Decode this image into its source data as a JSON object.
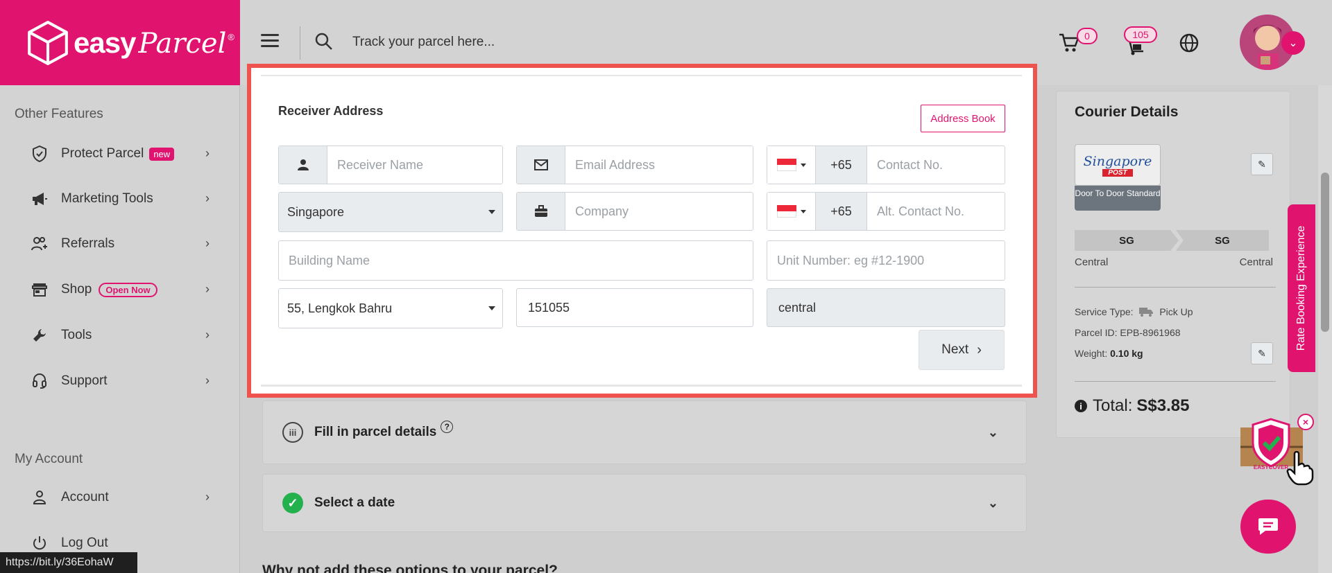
{
  "brand": {
    "easy": "easy",
    "parcel": "Parcel",
    "reg": "®",
    "color": "#e0146f"
  },
  "topbar": {
    "search_placeholder": "Track your parcel here...",
    "cart_count": "0",
    "notif_count": "105"
  },
  "sidebar": {
    "section_other": "Other Features",
    "items": [
      {
        "label": "Protect Parcel",
        "badge": "new",
        "icon": "shield-icon"
      },
      {
        "label": "Marketing Tools",
        "icon": "megaphone-icon"
      },
      {
        "label": "Referrals",
        "icon": "users-icon"
      },
      {
        "label": "Shop",
        "badge": "Open Now",
        "icon": "store-icon"
      },
      {
        "label": "Tools",
        "icon": "wrench-icon"
      },
      {
        "label": "Support",
        "icon": "headset-icon"
      }
    ],
    "section_account": "My Account",
    "account_items": [
      {
        "label": "Account",
        "icon": "user-icon"
      },
      {
        "label": "Log Out",
        "icon": "power-icon"
      }
    ]
  },
  "status_url": "https://bit.ly/36EohaW",
  "receiver": {
    "title": "Receiver Address",
    "address_book": "Address Book",
    "name_placeholder": "Receiver Name",
    "email_placeholder": "Email Address",
    "dial_code": "+65",
    "contact_placeholder": "Contact No.",
    "country": "Singapore",
    "company_placeholder": "Company",
    "alt_dial_code": "+65",
    "alt_contact_placeholder": "Alt. Contact No.",
    "building_placeholder": "Building Name",
    "unit_placeholder": "Unit Number: eg #12-1900",
    "street": "55, Lengkok Bahru",
    "postcode": "151055",
    "region": "central",
    "next": "Next"
  },
  "steps": [
    {
      "marker": "iii",
      "label": "Fill in parcel details"
    },
    {
      "marker": "✓",
      "label": "Select a date"
    }
  ],
  "why_heading": "Why not add these options to your parcel?",
  "courier": {
    "title": "Courier Details",
    "logo_line1": "Singapore",
    "logo_line2": "POST",
    "service": "Door To Door Standard",
    "from_code": "SG",
    "to_code": "SG",
    "from_region": "Central",
    "to_region": "Central",
    "service_type_label": "Service Type:",
    "service_type": "Pick Up",
    "parcel_id_label": "Parcel ID:",
    "parcel_id": "EPB-8961968",
    "weight_label": "Weight:",
    "weight": "0.10 kg",
    "total_label": "Total:",
    "total": "S$3.85"
  },
  "rate_tab": "Rate Booking Experience",
  "easycover_label": "EASYCOVER"
}
